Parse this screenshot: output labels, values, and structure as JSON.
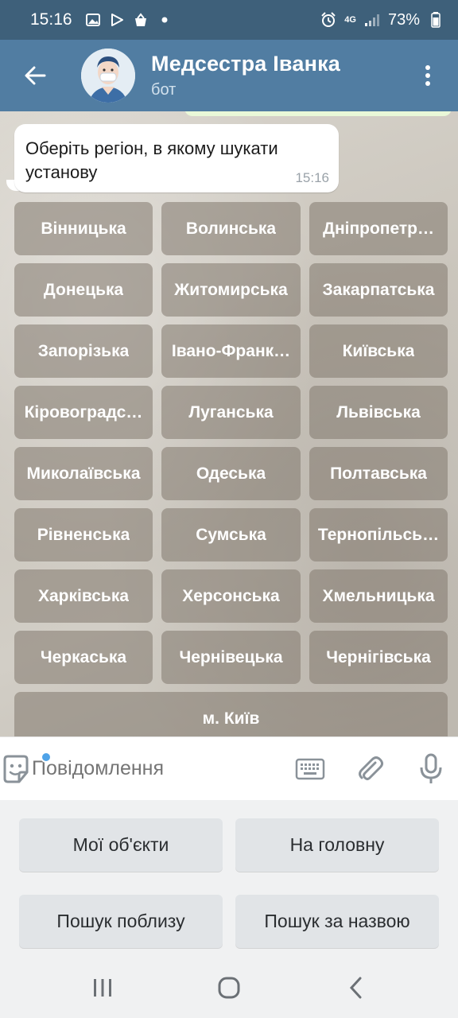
{
  "status_bar": {
    "time": "15:16",
    "network": "4G",
    "battery": "73%",
    "left_icons": [
      "gallery-icon",
      "play-store-icon",
      "shopping-bag-icon",
      "dot-icon"
    ],
    "right_icons": [
      "alarm-icon",
      "signal-icon",
      "battery-icon"
    ]
  },
  "header": {
    "title": "Медсестра Іванка",
    "subtitle": "бот",
    "background": "#517da2"
  },
  "message": {
    "text": "Оберіть регіон, в якому шукати установу",
    "time": "15:16"
  },
  "inline_keyboard": {
    "buttons": [
      "Вінницька",
      "Волинська",
      "Дніпропетр…",
      "Донецька",
      "Житомирська",
      "Закарпатська",
      "Запорізька",
      "Івано-Франк…",
      "Київська",
      "Кіровоградс…",
      "Луганська",
      "Львівська",
      "Миколаївська",
      "Одеська",
      "Полтавська",
      "Рівненська",
      "Сумська",
      "Тернопільсь…",
      "Харківська",
      "Херсонська",
      "Хмельницька",
      "Черкаська",
      "Чернівецька",
      "Чернігівська"
    ],
    "wide_button": "м. Київ"
  },
  "input": {
    "placeholder": "Повідомлення"
  },
  "reply_keyboard": {
    "buttons": [
      "Мої об'єкти",
      "На головну",
      "Пошук поблизу",
      "Пошук за назвою"
    ]
  },
  "colors": {
    "accent": "#517da2",
    "status_bar": "#3e607a",
    "bubble": "#ffffff"
  }
}
